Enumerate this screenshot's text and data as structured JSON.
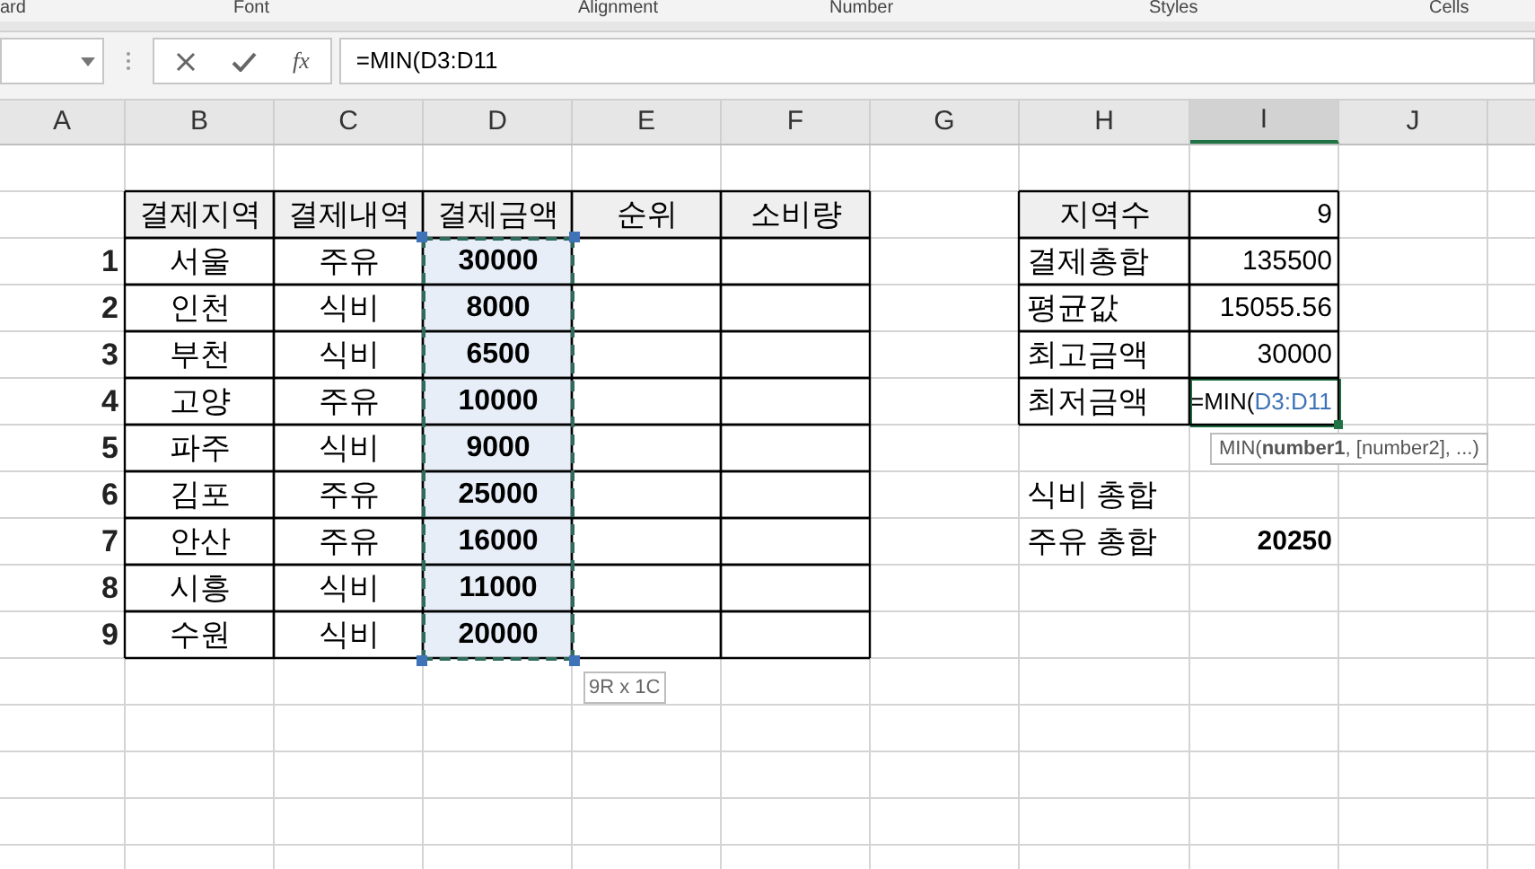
{
  "ribbon_groups": [
    {
      "label": "ard"
    },
    {
      "label": "Font"
    },
    {
      "label": "Alignment"
    },
    {
      "label": "Number"
    },
    {
      "label": "Styles"
    },
    {
      "label": "Cells"
    }
  ],
  "formula_bar": {
    "fx": "fx",
    "formula": "=MIN(D3:D11"
  },
  "column_headers": [
    {
      "label": "A",
      "selected": false
    },
    {
      "label": "B",
      "selected": false
    },
    {
      "label": "C",
      "selected": false
    },
    {
      "label": "D",
      "selected": false
    },
    {
      "label": "E",
      "selected": false
    },
    {
      "label": "F",
      "selected": false
    },
    {
      "label": "G",
      "selected": false
    },
    {
      "label": "H",
      "selected": false
    },
    {
      "label": "I",
      "selected": true
    },
    {
      "label": "J",
      "selected": false
    }
  ],
  "payments_table": {
    "columns": [
      "결제지역",
      "결제내역",
      "결제금액",
      "순위",
      "소비량"
    ],
    "amounts_selected": true,
    "rows": [
      {
        "index": "1",
        "region": "서울",
        "category": "주유",
        "amount": "30000"
      },
      {
        "index": "2",
        "region": "인천",
        "category": "식비",
        "amount": "8000"
      },
      {
        "index": "3",
        "region": "부천",
        "category": "식비",
        "amount": "6500"
      },
      {
        "index": "4",
        "region": "고양",
        "category": "주유",
        "amount": "10000"
      },
      {
        "index": "5",
        "region": "파주",
        "category": "식비",
        "amount": "9000"
      },
      {
        "index": "6",
        "region": "김포",
        "category": "주유",
        "amount": "25000"
      },
      {
        "index": "7",
        "region": "안산",
        "category": "주유",
        "amount": "16000"
      },
      {
        "index": "8",
        "region": "시흥",
        "category": "식비",
        "amount": "11000"
      },
      {
        "index": "9",
        "region": "수원",
        "category": "식비",
        "amount": "20000"
      }
    ],
    "selection_size": "9R x 1C"
  },
  "summary": [
    {
      "label": "지역수",
      "value": "9",
      "editing": false
    },
    {
      "label": "결제총합",
      "value": "135500",
      "editing": false
    },
    {
      "label": "평균값",
      "value": "15055.56",
      "editing": false
    },
    {
      "label": "최고금액",
      "value": "30000",
      "editing": false
    },
    {
      "label": "최저금액",
      "value": "=MIN(",
      "ref": "D3:D11",
      "editing": true
    }
  ],
  "function_tooltip": "MIN(**number1**, [number2], ...)",
  "totals": [
    {
      "label": "식비 총합"
    },
    {
      "label": "주유 총합",
      "value": "20250"
    }
  ]
}
